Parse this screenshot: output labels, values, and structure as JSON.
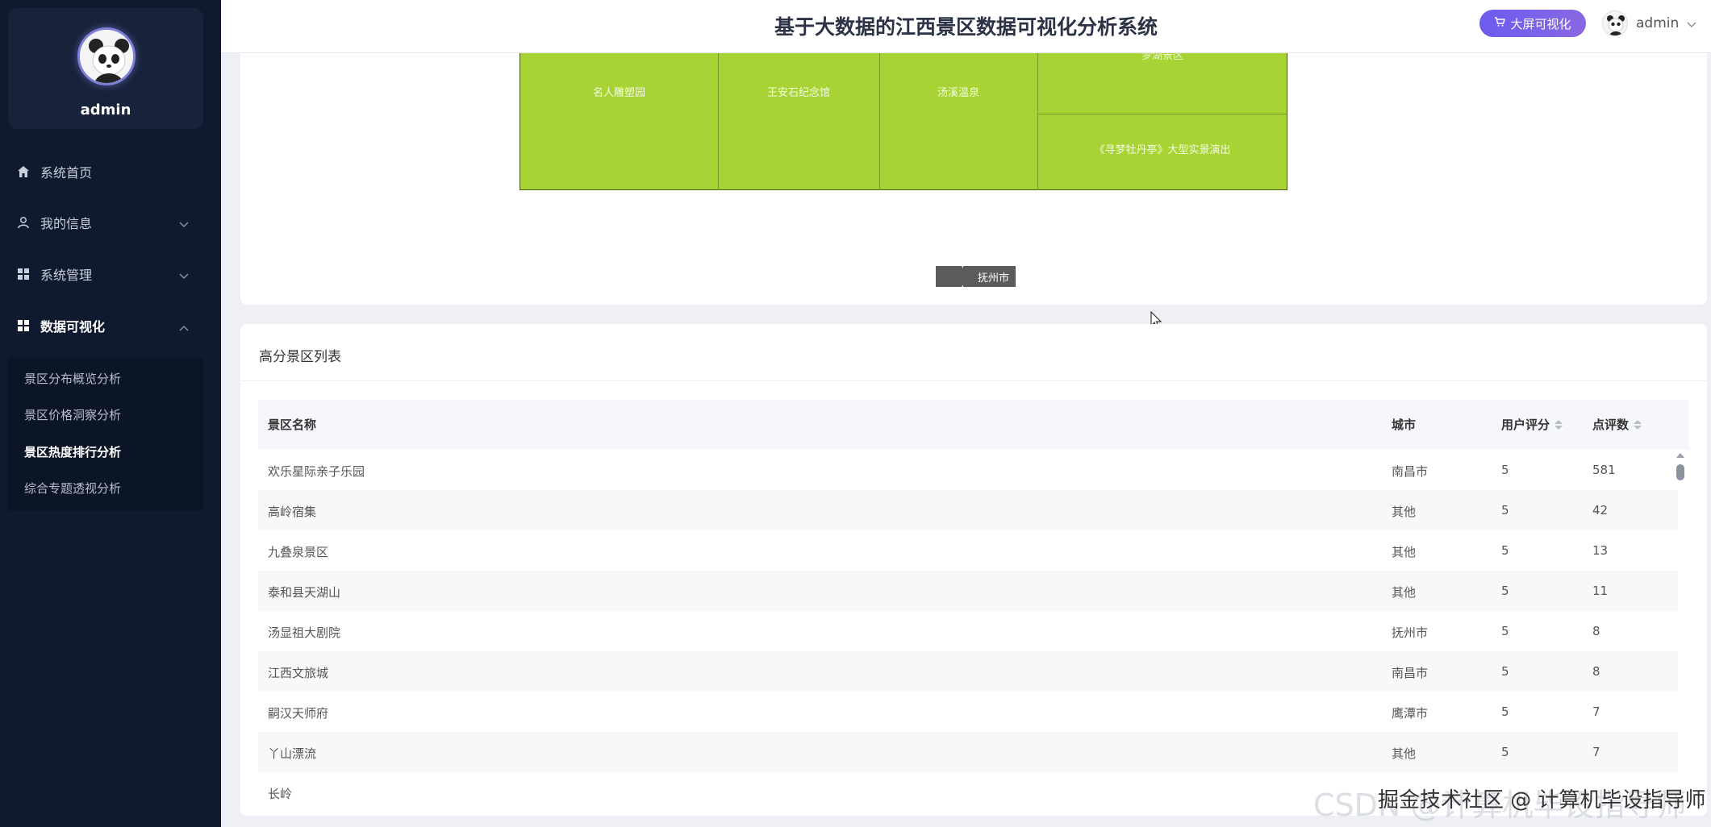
{
  "sidebar": {
    "profile_name": "admin",
    "items": [
      {
        "label": "系统首页",
        "icon": "home-icon"
      },
      {
        "label": "我的信息",
        "icon": "user-icon"
      },
      {
        "label": "系统管理",
        "icon": "grid-icon"
      },
      {
        "label": "数据可视化",
        "icon": "grid-icon"
      }
    ],
    "sub_items": [
      {
        "label": "景区分布概览分析"
      },
      {
        "label": "景区价格洞察分析"
      },
      {
        "label": "景区热度排行分析"
      },
      {
        "label": "综合专题透视分析"
      }
    ]
  },
  "header": {
    "title": "基于大数据的江西景区数据可视化分析系统",
    "big_screen_label": "大屏可视化",
    "user_name": "admin"
  },
  "treemap": {
    "cells": [
      {
        "label": "名人雕塑园"
      },
      {
        "label": "王安石纪念馆"
      },
      {
        "label": "汤溪温泉"
      },
      {
        "label": "梦湖景区"
      },
      {
        "label": "《寻梦牡丹亭》大型实景演出"
      }
    ],
    "breadcrumb": "抚州市",
    "color": "#a8d335"
  },
  "table": {
    "title": "高分景区列表",
    "columns": [
      "景区名称",
      "城市",
      "用户评分",
      "点评数"
    ],
    "rows": [
      [
        "欢乐星际亲子乐园",
        "南昌市",
        "5",
        "581"
      ],
      [
        "高岭宿集",
        "其他",
        "5",
        "42"
      ],
      [
        "九叠泉景区",
        "其他",
        "5",
        "13"
      ],
      [
        "泰和县天湖山",
        "其他",
        "5",
        "11"
      ],
      [
        "汤显祖大剧院",
        "抚州市",
        "5",
        "8"
      ],
      [
        "江西文旅城",
        "南昌市",
        "5",
        "8"
      ],
      [
        "嗣汉天师府",
        "鹰潭市",
        "5",
        "7"
      ],
      [
        "丫山漂流",
        "其他",
        "5",
        "7"
      ],
      [
        "长岭",
        "",
        "",
        ""
      ]
    ]
  },
  "watermark": {
    "back": "CSDN @计算机毕设指导师",
    "front": "掘金技术社区 @ 计算机毕设指导师"
  }
}
